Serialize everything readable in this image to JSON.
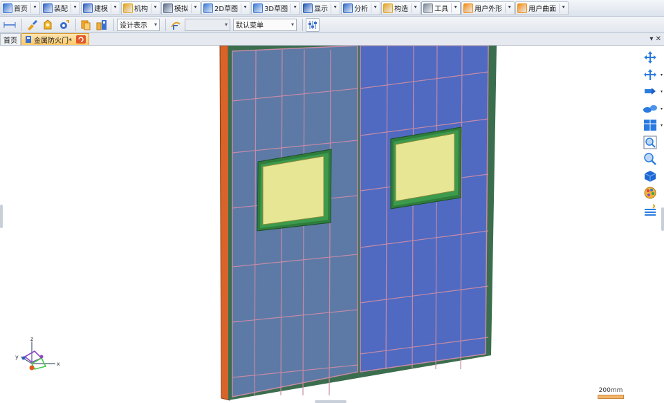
{
  "menubar": {
    "tabs": [
      {
        "label": "首页",
        "icon": "home-icon",
        "color": "#2e6fd1"
      },
      {
        "label": "装配",
        "icon": "assembly-icon",
        "color": "#2d64c8"
      },
      {
        "label": "建模",
        "icon": "modeling-icon",
        "color": "#2b5fc2"
      },
      {
        "label": "机构",
        "icon": "mechanism-icon",
        "color": "#e4a11b"
      },
      {
        "label": "模拟",
        "icon": "simulation-icon",
        "color": "#5a6d8a"
      },
      {
        "label": "2D草图",
        "icon": "sketch-2d-icon",
        "color": "#3a78d6"
      },
      {
        "label": "3D草图",
        "icon": "sketch-3d-icon",
        "color": "#3a78d6"
      },
      {
        "label": "显示",
        "icon": "display-icon",
        "color": "#1e58b8"
      },
      {
        "label": "分析",
        "icon": "analysis-icon",
        "color": "#2f6bc9"
      },
      {
        "label": "构造",
        "icon": "construct-icon",
        "color": "#e3a31f"
      },
      {
        "label": "工具",
        "icon": "tools-icon",
        "color": "#7b8797"
      },
      {
        "label": "用户外形",
        "icon": "user-shape-icon",
        "color": "#f08a12"
      },
      {
        "label": "用户曲面",
        "icon": "user-surface-icon",
        "color": "#f08a12"
      }
    ],
    "active_index": 10
  },
  "toolbar": {
    "display_mode": "设计表示",
    "blank_select": "",
    "menu_select": "默认菜单"
  },
  "tabstrip": {
    "home_tab": "首页",
    "doc_tab": "金属防火门*",
    "pin_symbol": "▾ ✕"
  },
  "viewport": {
    "axis_labels": {
      "x": "x",
      "y": "y",
      "z": "z"
    },
    "scale_label": "200mm"
  },
  "colors": {
    "frame_orange": "#d8642a",
    "panel_left": "#5c7aa5",
    "panel_right": "#4f6ac0",
    "seam_pink": "#c88aa8",
    "frame_green": "#3b6e4e",
    "window_green": "#2e7d3c",
    "glass_yellow": "#e6e694"
  }
}
